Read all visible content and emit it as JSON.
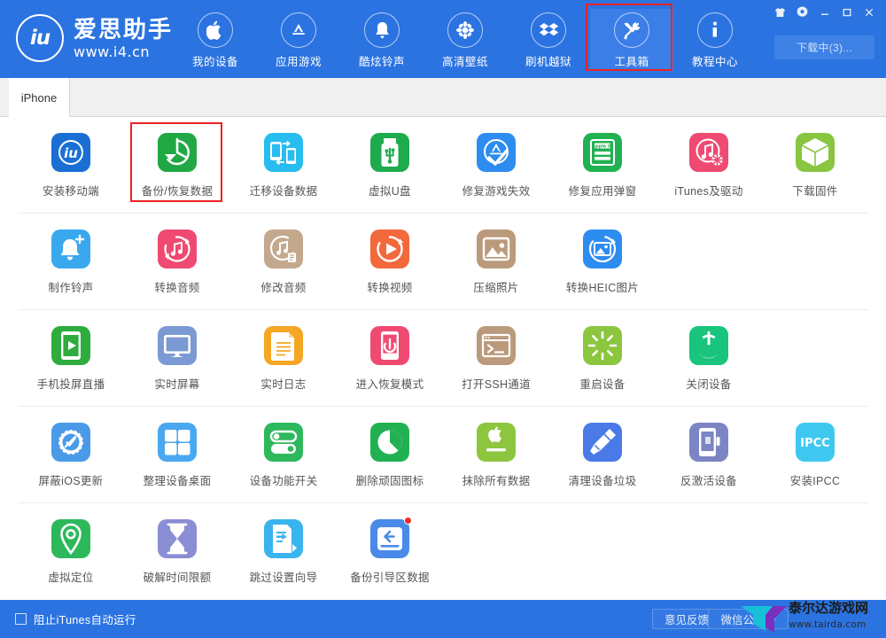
{
  "window": {
    "controls": [
      {
        "name": "skin-icon",
        "label": "皮肤"
      },
      {
        "name": "settings-gear-icon",
        "label": "设置"
      },
      {
        "name": "minimize-icon",
        "label": "最小化"
      },
      {
        "name": "maximize-icon",
        "label": "最大化"
      },
      {
        "name": "close-icon",
        "label": "关闭"
      }
    ],
    "download_button": "下载中(3)..."
  },
  "brand": {
    "mark": "iu",
    "name": "爱思助手",
    "url": "www.i4.cn"
  },
  "nav": {
    "items": [
      {
        "label": "我的设备",
        "icon": "apple-icon",
        "active": false
      },
      {
        "label": "应用游戏",
        "icon": "appstore-icon",
        "active": false
      },
      {
        "label": "酷炫铃声",
        "icon": "bell-icon",
        "active": false
      },
      {
        "label": "高清壁纸",
        "icon": "flower-icon",
        "active": false
      },
      {
        "label": "刷机越狱",
        "icon": "dropbox-icon",
        "active": false
      },
      {
        "label": "工具箱",
        "icon": "tools-icon",
        "active": true,
        "highlighted": true
      },
      {
        "label": "教程中心",
        "icon": "info-icon",
        "active": false
      }
    ]
  },
  "tabs": [
    {
      "label": "iPhone",
      "active": true
    }
  ],
  "tools": {
    "rows": [
      [
        {
          "label": "安装移动端",
          "icon": "i4-app-icon",
          "color": "#1a6fd4"
        },
        {
          "label": "备份/恢复数据",
          "icon": "backup-restore-icon",
          "color": "#21a845",
          "highlighted": true
        },
        {
          "label": "迁移设备数据",
          "icon": "migrate-device-icon",
          "color": "#28bdf0"
        },
        {
          "label": "虚拟U盘",
          "icon": "usb-drive-icon",
          "color": "#1eab4e"
        },
        {
          "label": "修复游戏失效",
          "icon": "fix-game-icon",
          "color": "#2d8cf0"
        },
        {
          "label": "修复应用弹窗",
          "icon": "apple-id-icon",
          "color": "#22b152"
        },
        {
          "label": "iTunes及驱动",
          "icon": "itunes-driver-icon",
          "color": "#ef4a72"
        },
        {
          "label": "下载固件",
          "icon": "firmware-box-icon",
          "color": "#88c540"
        }
      ],
      [
        {
          "label": "制作铃声",
          "icon": "make-ringtone-icon",
          "color": "#3aa8ef"
        },
        {
          "label": "转换音频",
          "icon": "convert-audio-icon",
          "color": "#ef4a72"
        },
        {
          "label": "修改音频",
          "icon": "edit-audio-icon",
          "color": "#c4a88c"
        },
        {
          "label": "转换视频",
          "icon": "convert-video-icon",
          "color": "#f2693c"
        },
        {
          "label": "压缩照片",
          "icon": "compress-photo-icon",
          "color": "#bb9a7c"
        },
        {
          "label": "转换HEIC图片",
          "icon": "heic-convert-icon",
          "color": "#2d8cf0"
        }
      ],
      [
        {
          "label": "手机投屏直播",
          "icon": "screen-cast-icon",
          "color": "#2eac3e"
        },
        {
          "label": "实时屏幕",
          "icon": "realtime-screen-icon",
          "color": "#7b9ad4"
        },
        {
          "label": "实时日志",
          "icon": "realtime-log-icon",
          "color": "#f5a623"
        },
        {
          "label": "进入恢复模式",
          "icon": "recovery-mode-icon",
          "color": "#ef4a72"
        },
        {
          "label": "打开SSH通道",
          "icon": "ssh-terminal-icon",
          "color": "#bb9a7c"
        },
        {
          "label": "重启设备",
          "icon": "reboot-device-icon",
          "color": "#8cc63f"
        },
        {
          "label": "关闭设备",
          "icon": "power-off-icon",
          "color": "#19c47d"
        }
      ],
      [
        {
          "label": "屏蔽iOS更新",
          "icon": "block-update-icon",
          "color": "#4a9ae8"
        },
        {
          "label": "整理设备桌面",
          "icon": "arrange-desktop-icon",
          "color": "#4aa8f0"
        },
        {
          "label": "设备功能开关",
          "icon": "feature-toggle-icon",
          "color": "#2eb85c"
        },
        {
          "label": "删除顽固图标",
          "icon": "delete-icon-icon",
          "color": "#22b152"
        },
        {
          "label": "抹除所有数据",
          "icon": "erase-data-icon",
          "color": "#8cc63f"
        },
        {
          "label": "清理设备垃圾",
          "icon": "clean-junk-icon",
          "color": "#4a7ae8"
        },
        {
          "label": "反激活设备",
          "icon": "deactivate-icon",
          "color": "#7b85c4"
        },
        {
          "label": "安装IPCC",
          "icon": "ipcc-icon",
          "color": "#3ec8f0",
          "text": "IPCC"
        }
      ],
      [
        {
          "label": "虚拟定位",
          "icon": "virtual-location-icon",
          "color": "#2eb85c"
        },
        {
          "label": "破解时间限额",
          "icon": "time-limit-icon",
          "color": "#8a8ed4"
        },
        {
          "label": "跳过设置向导",
          "icon": "skip-setup-icon",
          "color": "#3ab4ef"
        },
        {
          "label": "备份引导区数据",
          "icon": "backup-boot-icon",
          "color": "#4a8ae8",
          "badge": true
        }
      ]
    ]
  },
  "footer": {
    "checkbox_label": "阻止iTunes自动运行",
    "checkbox_checked": false,
    "buttons": [
      "意见反馈",
      "微信公众号"
    ]
  },
  "watermark": {
    "name": "泰尔达游戏网",
    "url": "www.tairda.com"
  }
}
